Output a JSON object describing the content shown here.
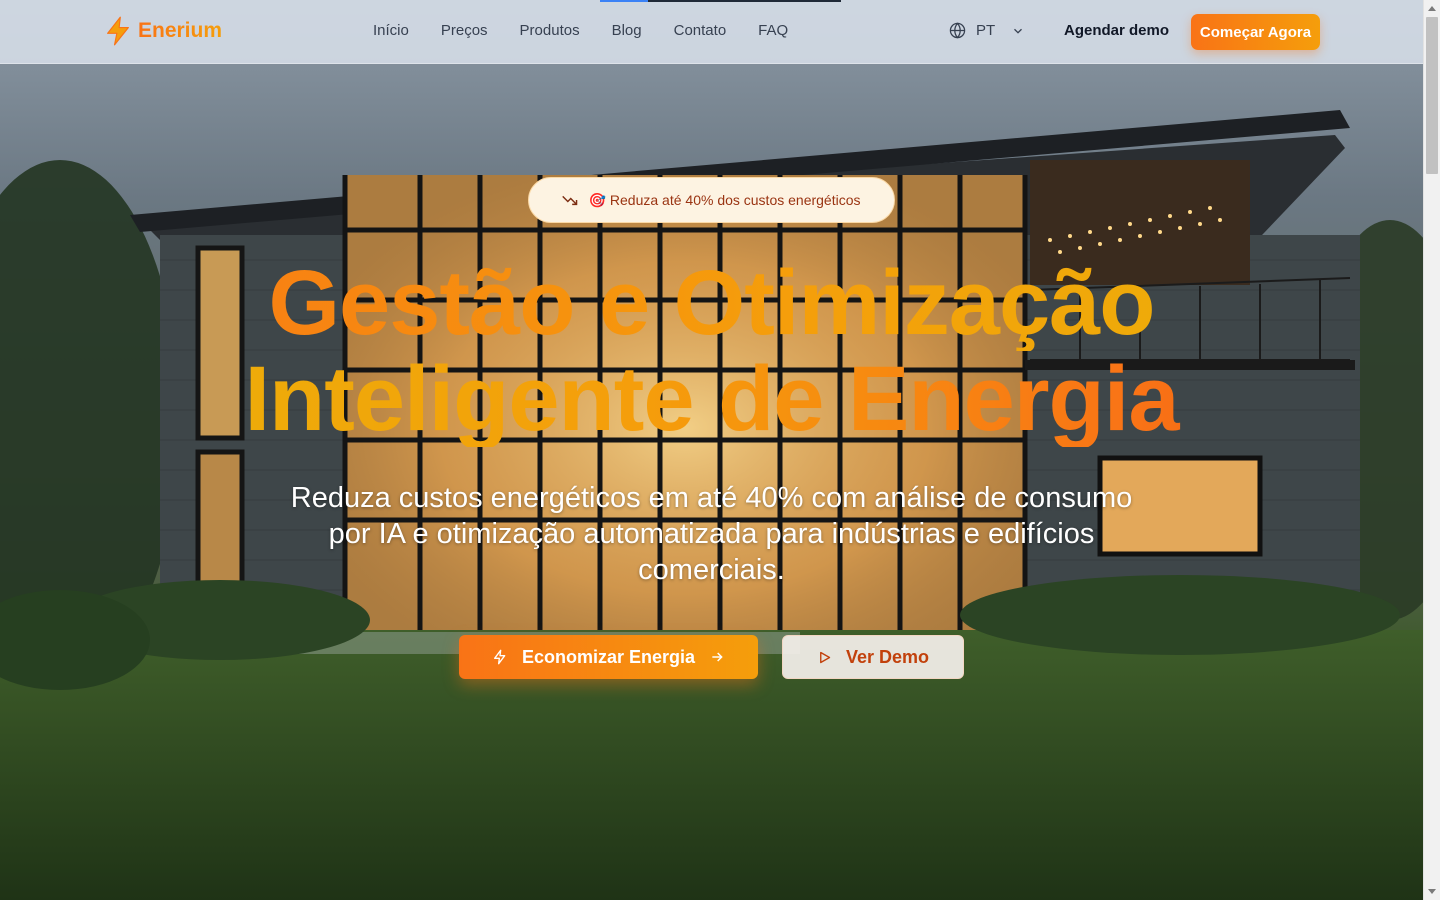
{
  "brand": {
    "name": "Enerium"
  },
  "nav": {
    "links": [
      "Início",
      "Preços",
      "Produtos",
      "Blog",
      "Contato",
      "FAQ"
    ],
    "language": "PT",
    "demo_label": "Agendar demo",
    "cta_label": "Começar Agora"
  },
  "hero": {
    "badge_text": "Reduza até 40% dos custos energéticos",
    "badge_emoji": "🎯",
    "headline_line1": "Gestão e Otimização",
    "headline_line2": "Inteligente de Energia",
    "subtitle": "Reduza custos energéticos em até 40% com análise de consumo por IA e otimização automatizada para indústrias e edifícios comerciais.",
    "primary_button": "Economizar Energia",
    "secondary_button": "Ver Demo"
  },
  "icons": {
    "logo": "lightning-bolt-icon",
    "language": "globe-icon",
    "language_toggle": "chevron-down-icon",
    "badge": "trending-down-icon",
    "primary_left": "zap-icon",
    "primary_right": "arrow-right-icon",
    "secondary": "play-icon"
  },
  "colors": {
    "accent_orange": "#f97316",
    "accent_amber": "#f59e0b",
    "badge_bg": "#fdf3e2",
    "secondary_text": "#c2410c"
  }
}
